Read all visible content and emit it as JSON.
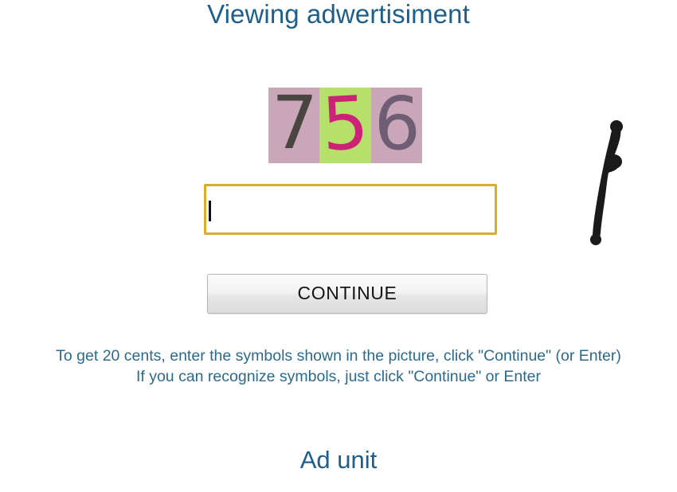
{
  "header": {
    "title": "Viewing adwertisiment"
  },
  "captcha": {
    "name": "captcha-image",
    "value": "756",
    "cells": [
      {
        "symbol": "7",
        "background": "#c9a6b8",
        "color": "#4a4540"
      },
      {
        "symbol": "5",
        "background": "#b5e06a",
        "color": "#cc2277"
      },
      {
        "symbol": "6",
        "background": "#c9a6b8",
        "color": "#6e5d73"
      }
    ]
  },
  "form": {
    "answer_value": "",
    "answer_placeholder": "",
    "border_color": "#d9ab2e",
    "continue_label": "CONTINUE"
  },
  "instructions": {
    "line1": "To get 20 cents, enter the symbols shown in the picture, click \"Continue\" (or Enter)",
    "line2": "If you can recognize symbols, just click \"Continue\" or Enter",
    "color": "#2d6a8a"
  },
  "annotation": {
    "name": "ink-stroke",
    "description": "hand drawn black stroke",
    "color": "#1a1a1a"
  },
  "footer": {
    "title": "Ad unit"
  },
  "theme": {
    "title_color": "#1d5f8a",
    "divider_color": "#c9c9c9",
    "page_background": "#ffffff"
  }
}
